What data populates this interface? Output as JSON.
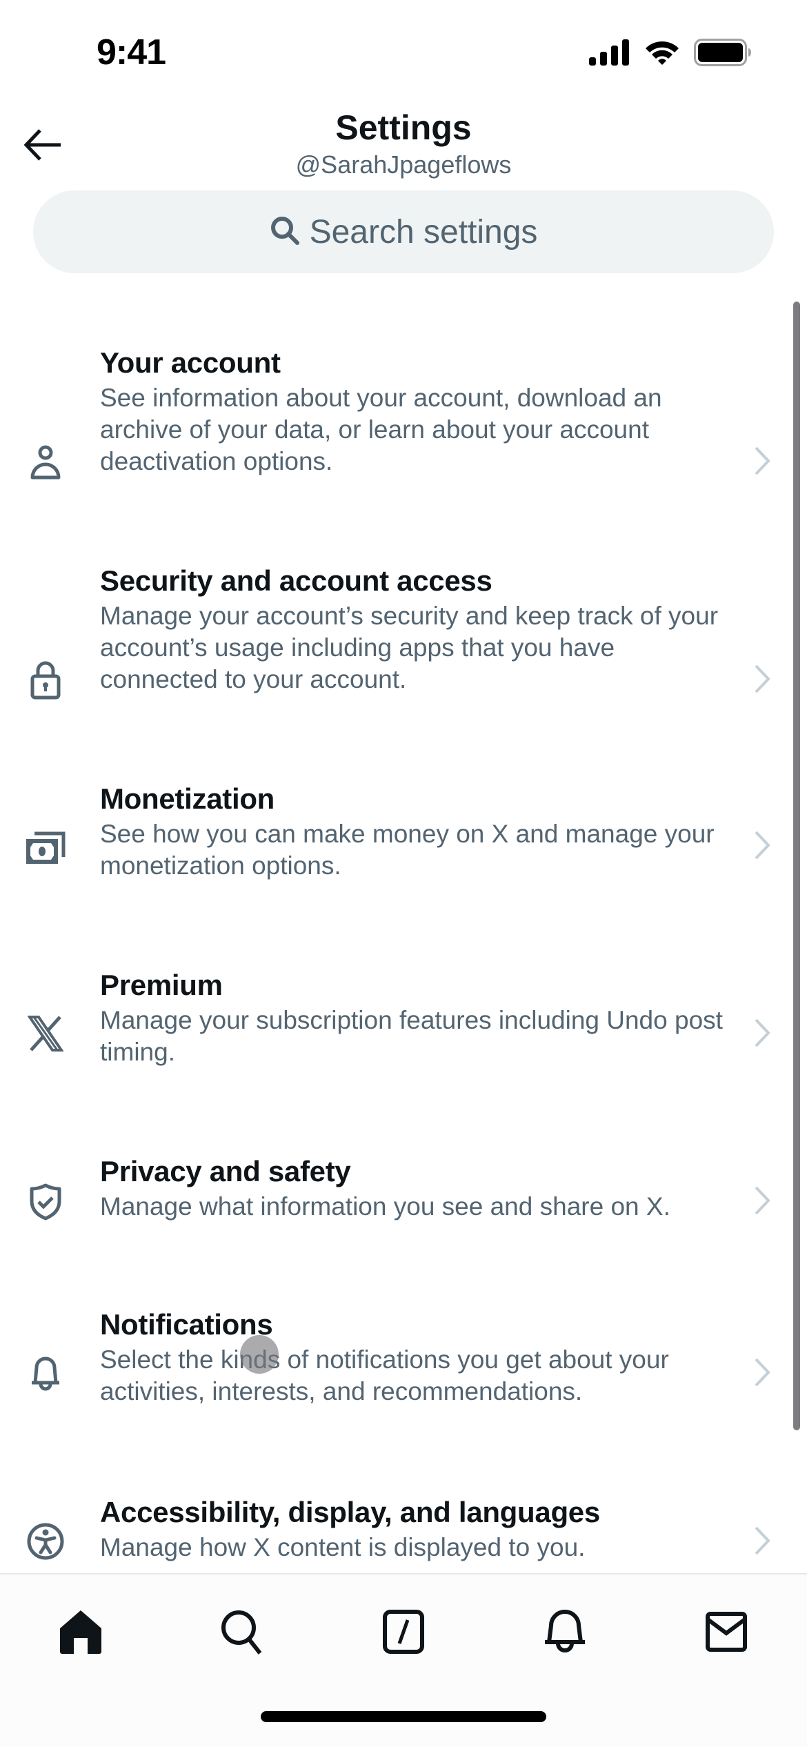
{
  "status_bar": {
    "time": "9:41",
    "icons": [
      "cellular-signal-icon",
      "wifi-icon",
      "battery-icon"
    ]
  },
  "header": {
    "back_icon": "arrow-left-icon",
    "title": "Settings",
    "subtitle": "@SarahJpageflows"
  },
  "search": {
    "icon": "search-icon",
    "placeholder": "Search settings",
    "value": ""
  },
  "settings_items": [
    {
      "icon": "person-icon",
      "title": "Your account",
      "description": "See information about your account, download an archive of your data, or learn about your account deactivation options."
    },
    {
      "icon": "lock-icon",
      "title": "Security and account access",
      "description": "Manage your account’s security and keep track of your account’s usage including apps that you have connected to your account."
    },
    {
      "icon": "money-icon",
      "title": "Monetization",
      "description": "See how you can make money on X and manage your monetization options."
    },
    {
      "icon": "x-logo-icon",
      "title": "Premium",
      "description": "Manage your subscription features including Undo post timing."
    },
    {
      "icon": "shield-check-icon",
      "title": "Privacy and safety",
      "description": "Manage what information you see and share on X."
    },
    {
      "icon": "bell-icon",
      "title": "Notifications",
      "description": "Select the kinds of notifications you get about your activities, interests, and recommendations."
    },
    {
      "icon": "accessibility-icon",
      "title": "Accessibility, display, and languages",
      "description": "Manage how X content is displayed to you."
    }
  ],
  "tab_bar": {
    "tabs": [
      {
        "name": "home",
        "icon": "home-icon",
        "active": true
      },
      {
        "name": "search",
        "icon": "search-icon",
        "active": false
      },
      {
        "name": "grok",
        "icon": "grok-icon",
        "active": false
      },
      {
        "name": "notifications",
        "icon": "bell-icon",
        "active": false
      },
      {
        "name": "messages",
        "icon": "mail-icon",
        "active": false
      }
    ]
  },
  "colors": {
    "text_primary": "#0f1419",
    "text_secondary": "#536471",
    "search_bg": "#eff3f4",
    "chevron": "#cfd9de",
    "scrollbar": "#7d7d80"
  }
}
